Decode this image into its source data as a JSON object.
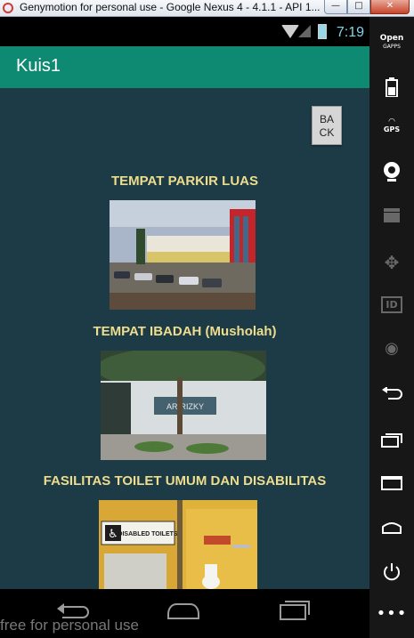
{
  "window": {
    "title": "Genymotion for personal use - Google Nexus 4 - 4.1.1 - API 1...",
    "minimize": "—",
    "maximize": "□",
    "close": "✕"
  },
  "statusbar": {
    "time": "7:19"
  },
  "app": {
    "title": "Kuis1"
  },
  "back_button": "BA\nCK",
  "sections": [
    {
      "heading": "TEMPAT PARKIR LUAS",
      "photo": "parking-photo"
    },
    {
      "heading": "TEMPAT IBADAH (Musholah)",
      "photo": "musholah-photo",
      "sign_text": "AR-RIZKY"
    },
    {
      "heading": "FASILITAS TOILET UMUM DAN DISABILITAS",
      "photo": "toilet-photo",
      "sign_text": "DISABLED TOILETS"
    }
  ],
  "watermark": "free for personal use",
  "sidebar": {
    "open_gapps_line1": "Open",
    "open_gapps_line2": "GAPPS",
    "gps_label": "GPS",
    "id_label": "ID"
  }
}
